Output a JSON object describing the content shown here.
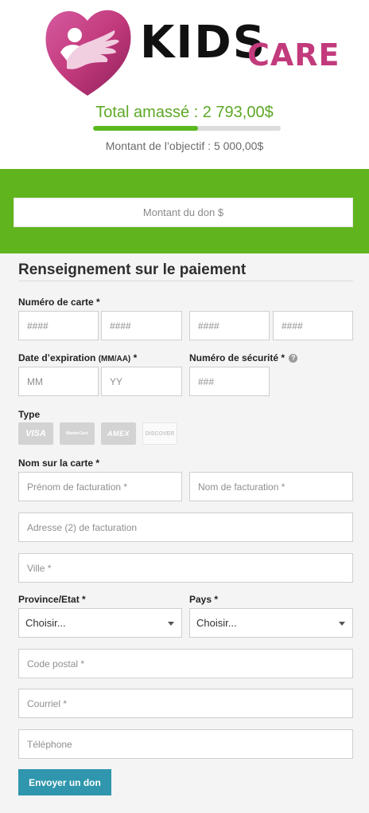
{
  "brand": {
    "name_part1": "KIDS",
    "name_part2": "CARE",
    "colors": {
      "magenta": "#c23a7c",
      "green": "#60b51e",
      "button": "#2f96ad"
    }
  },
  "campaign": {
    "total_raised": "Total amassé : 2 793,00$",
    "goal": "Montant de l’objectif : 5 000,00$",
    "progress_percent": 55.9
  },
  "donation": {
    "amount_placeholder": "Montant du don $"
  },
  "payment": {
    "section_title": "Renseignement sur le paiement",
    "card_number_label": "Numéro de carte *",
    "card_placeholders": [
      "####",
      "####",
      "####",
      "####"
    ],
    "expiry_label": "Date d’expiration",
    "expiry_format": "(MM/AA)",
    "expiry_required": " *",
    "month_placeholder": "MM",
    "year_placeholder": "YY",
    "security_label": "Numéro de sécurité *",
    "security_help_icon": "?",
    "security_placeholder": "###",
    "type_label": "Type",
    "card_types": [
      "VISA",
      "MasterCard",
      "AMEX",
      "DISCOVER"
    ],
    "name_on_card_label": "Nom sur la carte *",
    "first_name_placeholder": "Prénom de facturation *",
    "last_name_placeholder": "Nom de facturation *",
    "address2_placeholder": "Adresse (2) de facturation",
    "city_placeholder": "Ville *",
    "province_label": "Province/Etat *",
    "province_value": "Choisir...",
    "country_label": "Pays *",
    "country_value": "Choisir...",
    "postal_placeholder": "Code postal *",
    "email_placeholder": "Courriel *",
    "phone_placeholder": "Téléphone",
    "submit_label": "Envoyer un don"
  }
}
